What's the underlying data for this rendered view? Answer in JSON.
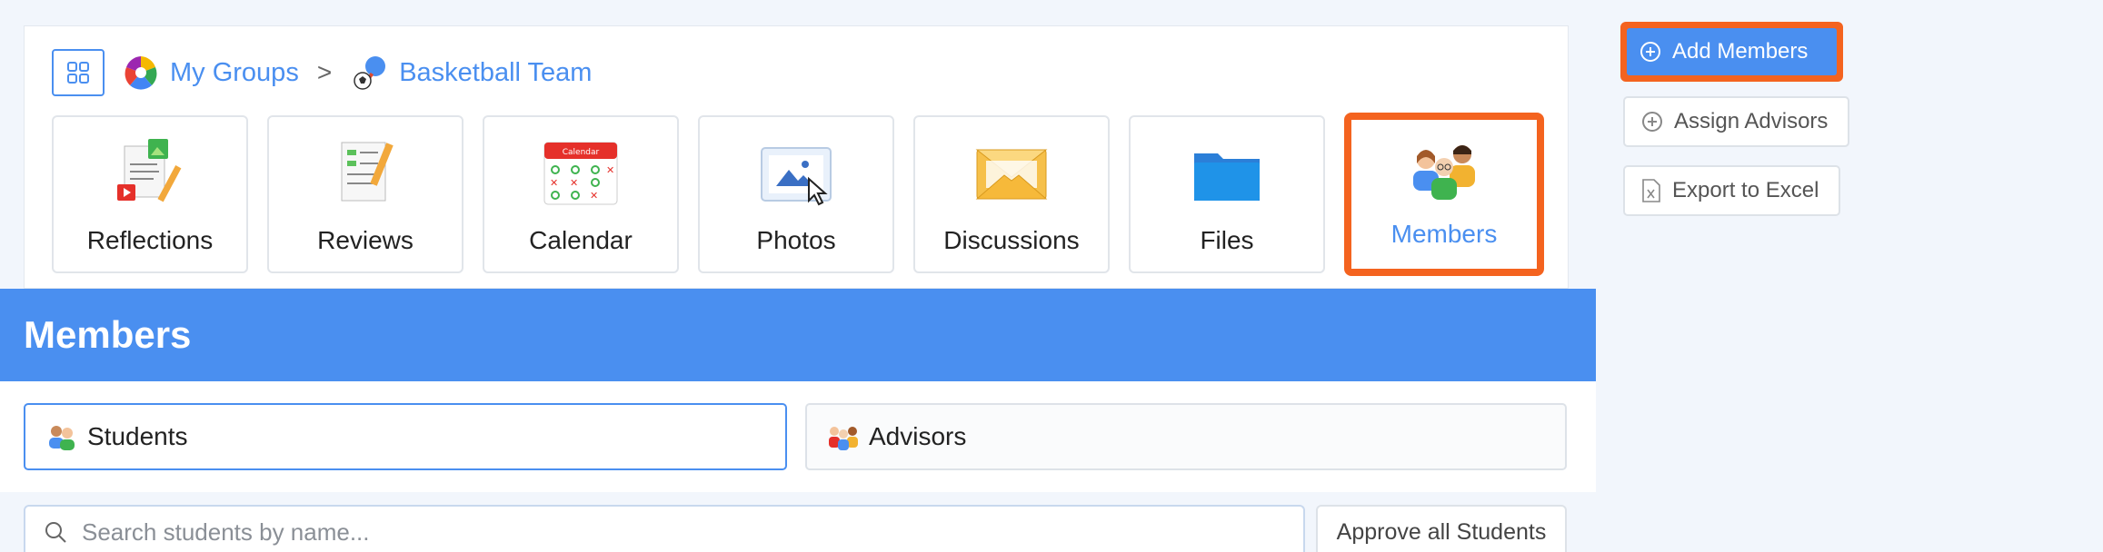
{
  "breadcrumb": {
    "items": [
      {
        "label": "My Groups",
        "icon": "group-wheel-icon"
      },
      {
        "label": "Basketball Team",
        "icon": "sports-balls-icon"
      }
    ],
    "separator": ">"
  },
  "tiles": [
    {
      "label": "Reflections",
      "icon": "reflections-icon"
    },
    {
      "label": "Reviews",
      "icon": "reviews-icon"
    },
    {
      "label": "Calendar",
      "icon": "calendar-icon",
      "icon_text": "Calendar"
    },
    {
      "label": "Photos",
      "icon": "photos-icon"
    },
    {
      "label": "Discussions",
      "icon": "envelope-icon"
    },
    {
      "label": "Files",
      "icon": "folder-icon"
    },
    {
      "label": "Members",
      "icon": "members-icon",
      "active": true
    }
  ],
  "actions": {
    "add_members": "Add Members",
    "assign_advisors": "Assign Advisors",
    "export_excel": "Export to Excel"
  },
  "members": {
    "title": "Members",
    "segments": [
      {
        "label": "Students",
        "active": true
      },
      {
        "label": "Advisors",
        "active": false
      }
    ],
    "search_placeholder": "Search students by name...",
    "approve_label": "Approve all Students"
  },
  "colors": {
    "accent": "#4a8ff0",
    "highlight": "#f4631f",
    "background": "#f2f6fc"
  }
}
